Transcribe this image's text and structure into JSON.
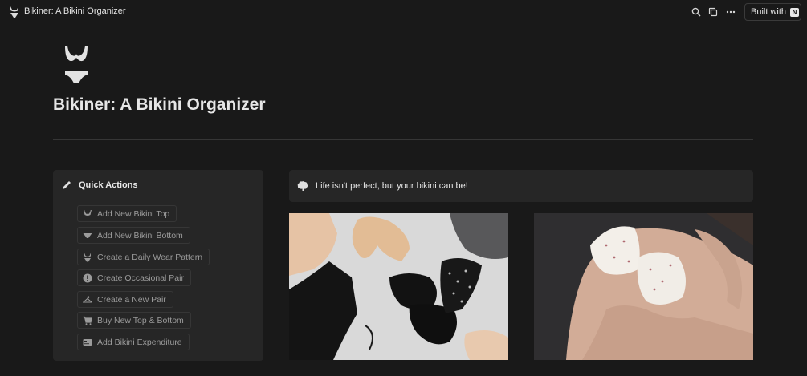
{
  "topbar": {
    "title": "Bikiner: A Bikini Organizer",
    "built_label": "Built with",
    "built_badge": "N",
    "icons": [
      "search-icon",
      "duplicate-icon",
      "more-icon"
    ]
  },
  "page": {
    "icon": "bikini-icon",
    "title": "Bikiner: A Bikini Organizer"
  },
  "quick_actions": {
    "title": "Quick Actions",
    "buttons": [
      {
        "label": "Add New Bikini Top",
        "icon": "bikini-top-icon"
      },
      {
        "label": "Add New Bikini Bottom",
        "icon": "bikini-bottom-icon"
      },
      {
        "label": "Create a Daily Wear Pattern",
        "icon": "bikini-icon"
      },
      {
        "label": "Create Occasional Pair",
        "icon": "alert-icon"
      },
      {
        "label": "Create a New Pair",
        "icon": "hanger-icon"
      },
      {
        "label": "Buy New Top & Bottom",
        "icon": "cart-icon"
      },
      {
        "label": "Add Bikini Expenditure",
        "icon": "card-icon"
      }
    ]
  },
  "quote": {
    "icon": "brain-icon",
    "text": "Life isn't perfect, but your bikini can be!"
  },
  "colors": {
    "background": "#191919",
    "panel": "#262626",
    "text": "#e6e6e6",
    "muted": "#9b9b9b"
  }
}
